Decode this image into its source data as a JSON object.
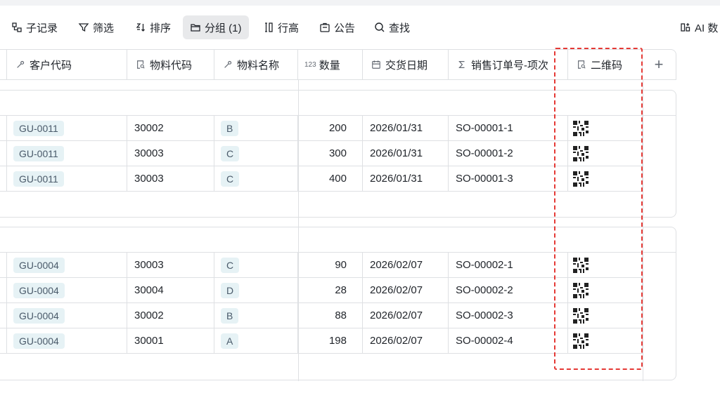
{
  "toolbar": {
    "sub_records": "子记录",
    "filter": "筛选",
    "sort": "排序",
    "group": "分组 (1)",
    "row_height": "行高",
    "notice": "公告",
    "find": "查找",
    "ai": "AI 数"
  },
  "columns": {
    "customer_code": "客户代码",
    "material_code": "物料代码",
    "material_name": "物料名称",
    "quantity_prefix": "123",
    "quantity": "数量",
    "delivery_date": "交货日期",
    "so_item": "销售订单号-项次",
    "qrcode": "二维码",
    "add": "+"
  },
  "groups": [
    {
      "rows": [
        {
          "customer": "GU-0011",
          "material_code": "30002",
          "material_name": "B",
          "qty": "200",
          "date": "2026/01/31",
          "so": "SO-00001-1"
        },
        {
          "customer": "GU-0011",
          "material_code": "30003",
          "material_name": "C",
          "qty": "300",
          "date": "2026/01/31",
          "so": "SO-00001-2"
        },
        {
          "customer": "GU-0011",
          "material_code": "30003",
          "material_name": "C",
          "qty": "400",
          "date": "2026/01/31",
          "so": "SO-00001-3"
        }
      ]
    },
    {
      "rows": [
        {
          "customer": "GU-0004",
          "material_code": "30003",
          "material_name": "C",
          "qty": "90",
          "date": "2026/02/07",
          "so": "SO-00002-1"
        },
        {
          "customer": "GU-0004",
          "material_code": "30004",
          "material_name": "D",
          "qty": "28",
          "date": "2026/02/07",
          "so": "SO-00002-2"
        },
        {
          "customer": "GU-0004",
          "material_code": "30002",
          "material_name": "B",
          "qty": "88",
          "date": "2026/02/07",
          "so": "SO-00002-3"
        },
        {
          "customer": "GU-0004",
          "material_code": "30001",
          "material_name": "A",
          "qty": "198",
          "date": "2026/02/07",
          "so": "SO-00002-4"
        }
      ]
    }
  ],
  "colors": {
    "tag_bg": "#e6f2f5",
    "border": "#dee0e3",
    "highlight": "#e53935",
    "active_toolbar_bg": "#e8e9eb"
  },
  "icons": {
    "sub_records": "sub-records-icon",
    "filter": "filter-icon",
    "sort": "sort-icon",
    "group": "folder-icon",
    "row_height": "row-height-icon",
    "notice": "notice-icon",
    "find": "search-icon",
    "ai": "ai-icon",
    "link_field": "link-icon",
    "lookup_field": "lookup-icon",
    "number_field": "number-icon",
    "date_field": "calendar-icon",
    "formula_field": "sigma-icon",
    "qr_cell": "qrcode-icon"
  }
}
